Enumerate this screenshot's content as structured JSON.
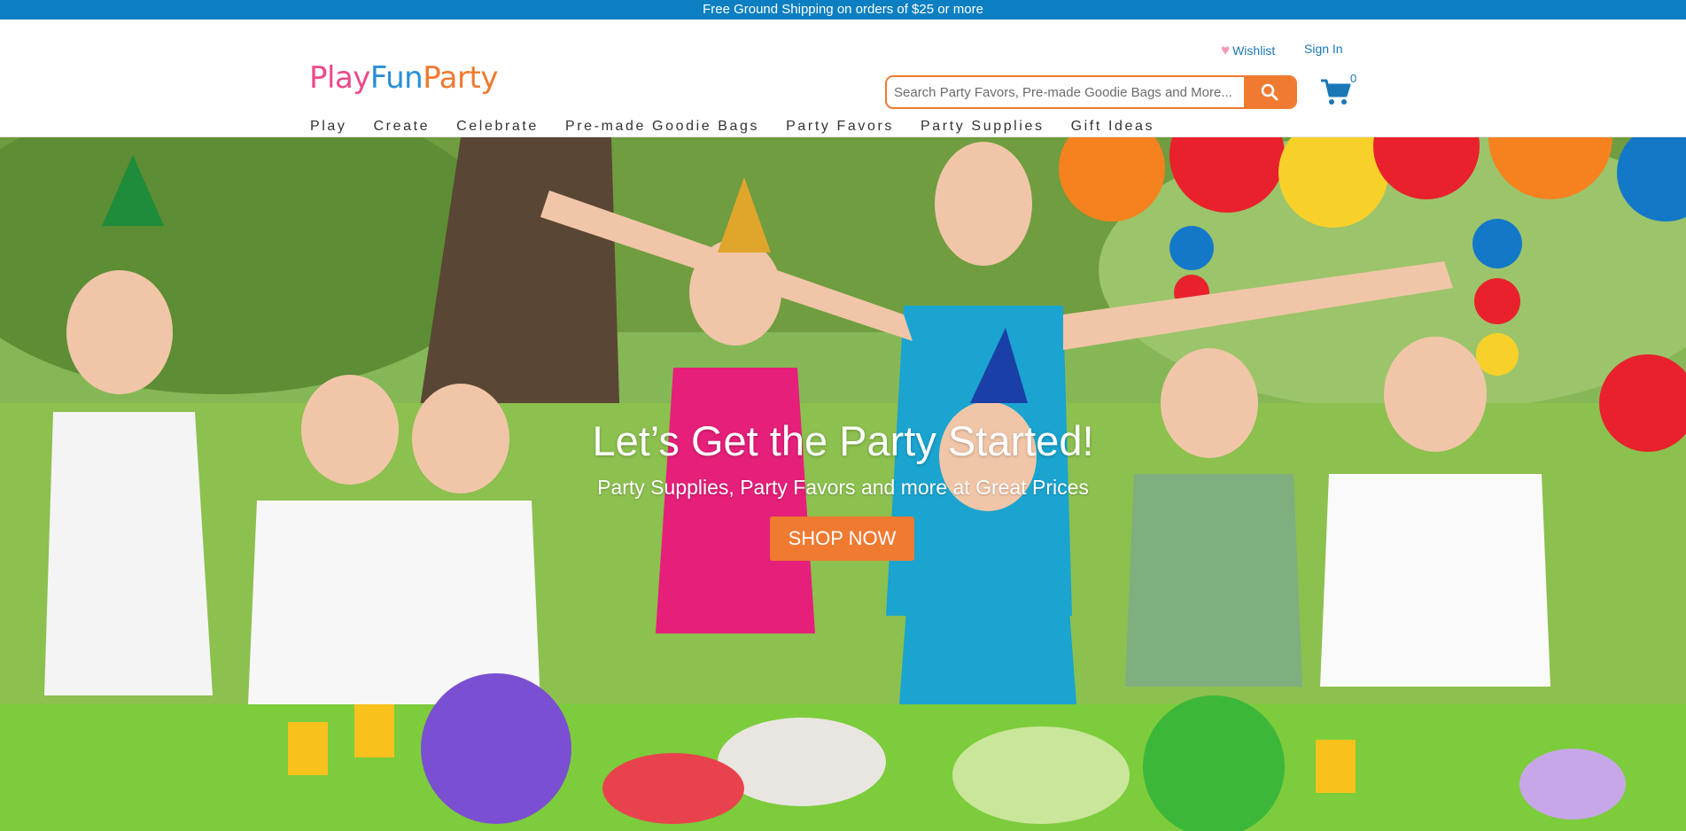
{
  "promo": {
    "text": "Free Ground Shipping on orders of $25 or more"
  },
  "header": {
    "logo": {
      "part1": "Play",
      "part2": "Fun",
      "part3": "Party"
    },
    "wishlist_label": "Wishlist",
    "signin_label": "Sign In",
    "search": {
      "placeholder": "Search Party Favors, Pre-made Goodie Bags and More...",
      "icon": "search-icon"
    },
    "cart": {
      "icon": "cart-icon",
      "count": "0"
    }
  },
  "nav": {
    "items": [
      {
        "label": "Play"
      },
      {
        "label": "Create"
      },
      {
        "label": "Celebrate"
      },
      {
        "label": "Pre-made Goodie Bags"
      },
      {
        "label": "Party Favors"
      },
      {
        "label": "Party Supplies"
      },
      {
        "label": "Gift Ideas"
      }
    ]
  },
  "hero": {
    "title": "Let’s Get the Party Started!",
    "subtitle": "Party Supplies, Party Favors and more at Great Prices",
    "cta_label": "SHOP NOW"
  },
  "colors": {
    "promo_bar": "#0b7fc1",
    "accent_orange": "#f07a30",
    "link_blue": "#1a77b6",
    "logo_pink": "#ec4a8c",
    "logo_blue": "#2a8fd6"
  }
}
